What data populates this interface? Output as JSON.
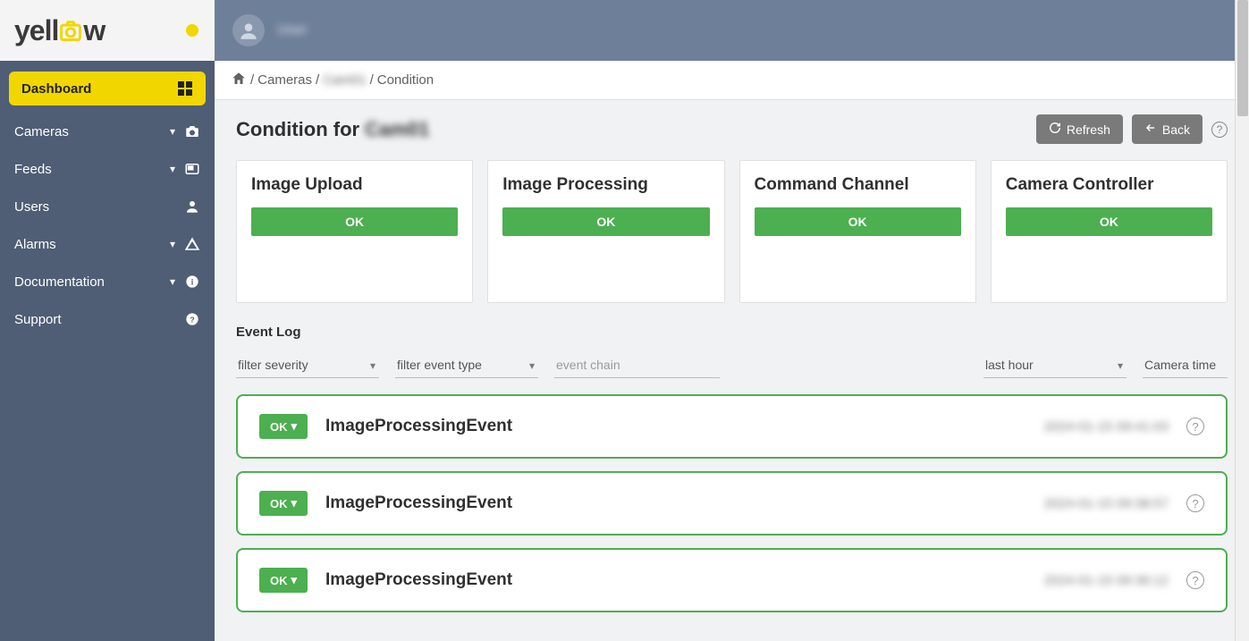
{
  "logo": {
    "text_pre": "yell",
    "text_post": "w"
  },
  "sidebar": {
    "items": [
      {
        "label": "Dashboard",
        "icon": "dashboard-icon",
        "active": true,
        "expandable": false
      },
      {
        "label": "Cameras",
        "icon": "camera-icon",
        "active": false,
        "expandable": true
      },
      {
        "label": "Feeds",
        "icon": "feed-icon",
        "active": false,
        "expandable": true
      },
      {
        "label": "Users",
        "icon": "user-icon",
        "active": false,
        "expandable": false
      },
      {
        "label": "Alarms",
        "icon": "warning-icon",
        "active": false,
        "expandable": true
      },
      {
        "label": "Documentation",
        "icon": "info-icon",
        "active": false,
        "expandable": true
      },
      {
        "label": "Support",
        "icon": "help-icon",
        "active": false,
        "expandable": false
      }
    ]
  },
  "topbar": {
    "username": "User"
  },
  "breadcrumb": {
    "sep1": "/",
    "level1": "Cameras",
    "sep2": "/",
    "level2": "Cam01",
    "sep3": "/",
    "level3": "Condition"
  },
  "page": {
    "title_prefix": "Condition for ",
    "title_subject": "Cam01"
  },
  "buttons": {
    "refresh": "Refresh",
    "back": "Back"
  },
  "status_cards": [
    {
      "title": "Image Upload",
      "status": "OK"
    },
    {
      "title": "Image Processing",
      "status": "OK"
    },
    {
      "title": "Command Channel",
      "status": "OK"
    },
    {
      "title": "Camera Controller",
      "status": "OK"
    }
  ],
  "event_log": {
    "section_title": "Event Log",
    "filter_severity": "filter severity",
    "filter_event_type": "filter event type",
    "event_chain_placeholder": "event chain",
    "time_range": "last hour",
    "timezone": "Camera time",
    "events": [
      {
        "status": "OK",
        "name": "ImageProcessingEvent",
        "time": "2024-01-15 09:41:03"
      },
      {
        "status": "OK",
        "name": "ImageProcessingEvent",
        "time": "2024-01-15 09:38:57"
      },
      {
        "status": "OK",
        "name": "ImageProcessingEvent",
        "time": "2024-01-15 09:36:12"
      }
    ]
  }
}
